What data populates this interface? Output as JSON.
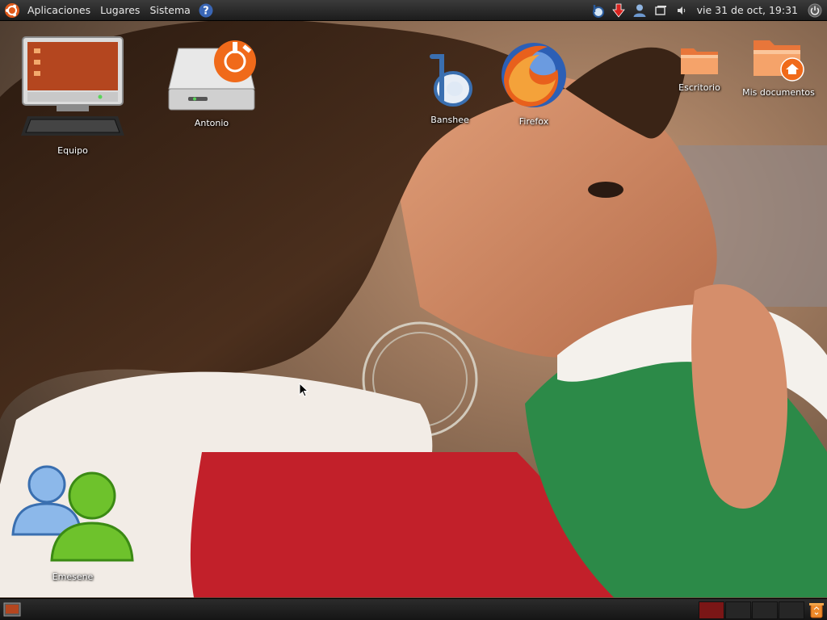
{
  "top_panel": {
    "menus": [
      "Aplicaciones",
      "Lugares",
      "Sistema"
    ],
    "clock": "vie 31 de oct, 19:31",
    "tray_icons": [
      "banshee-tray-icon",
      "download-arrow-icon",
      "user-icon",
      "window-icon",
      "volume-icon"
    ]
  },
  "desktop": {
    "icons": [
      {
        "id": "equipo",
        "label": "Equipo",
        "icon": "computer-icon"
      },
      {
        "id": "antonio",
        "label": "Antonio",
        "icon": "firewire-drive-icon"
      },
      {
        "id": "banshee",
        "label": "Banshee",
        "icon": "banshee-icon"
      },
      {
        "id": "firefox",
        "label": "Firefox",
        "icon": "firefox-icon"
      },
      {
        "id": "escritorio",
        "label": "Escritorio",
        "icon": "folder-icon"
      },
      {
        "id": "mis-documentos",
        "label": "Mis documentos",
        "icon": "home-folder-icon"
      },
      {
        "id": "emesene",
        "label": "Emesene",
        "icon": "messenger-icon"
      }
    ]
  },
  "colors": {
    "panel": "#1e1e1e",
    "ubuntu_orange": "#e05a1b",
    "active_workspace": "#7a1616"
  }
}
